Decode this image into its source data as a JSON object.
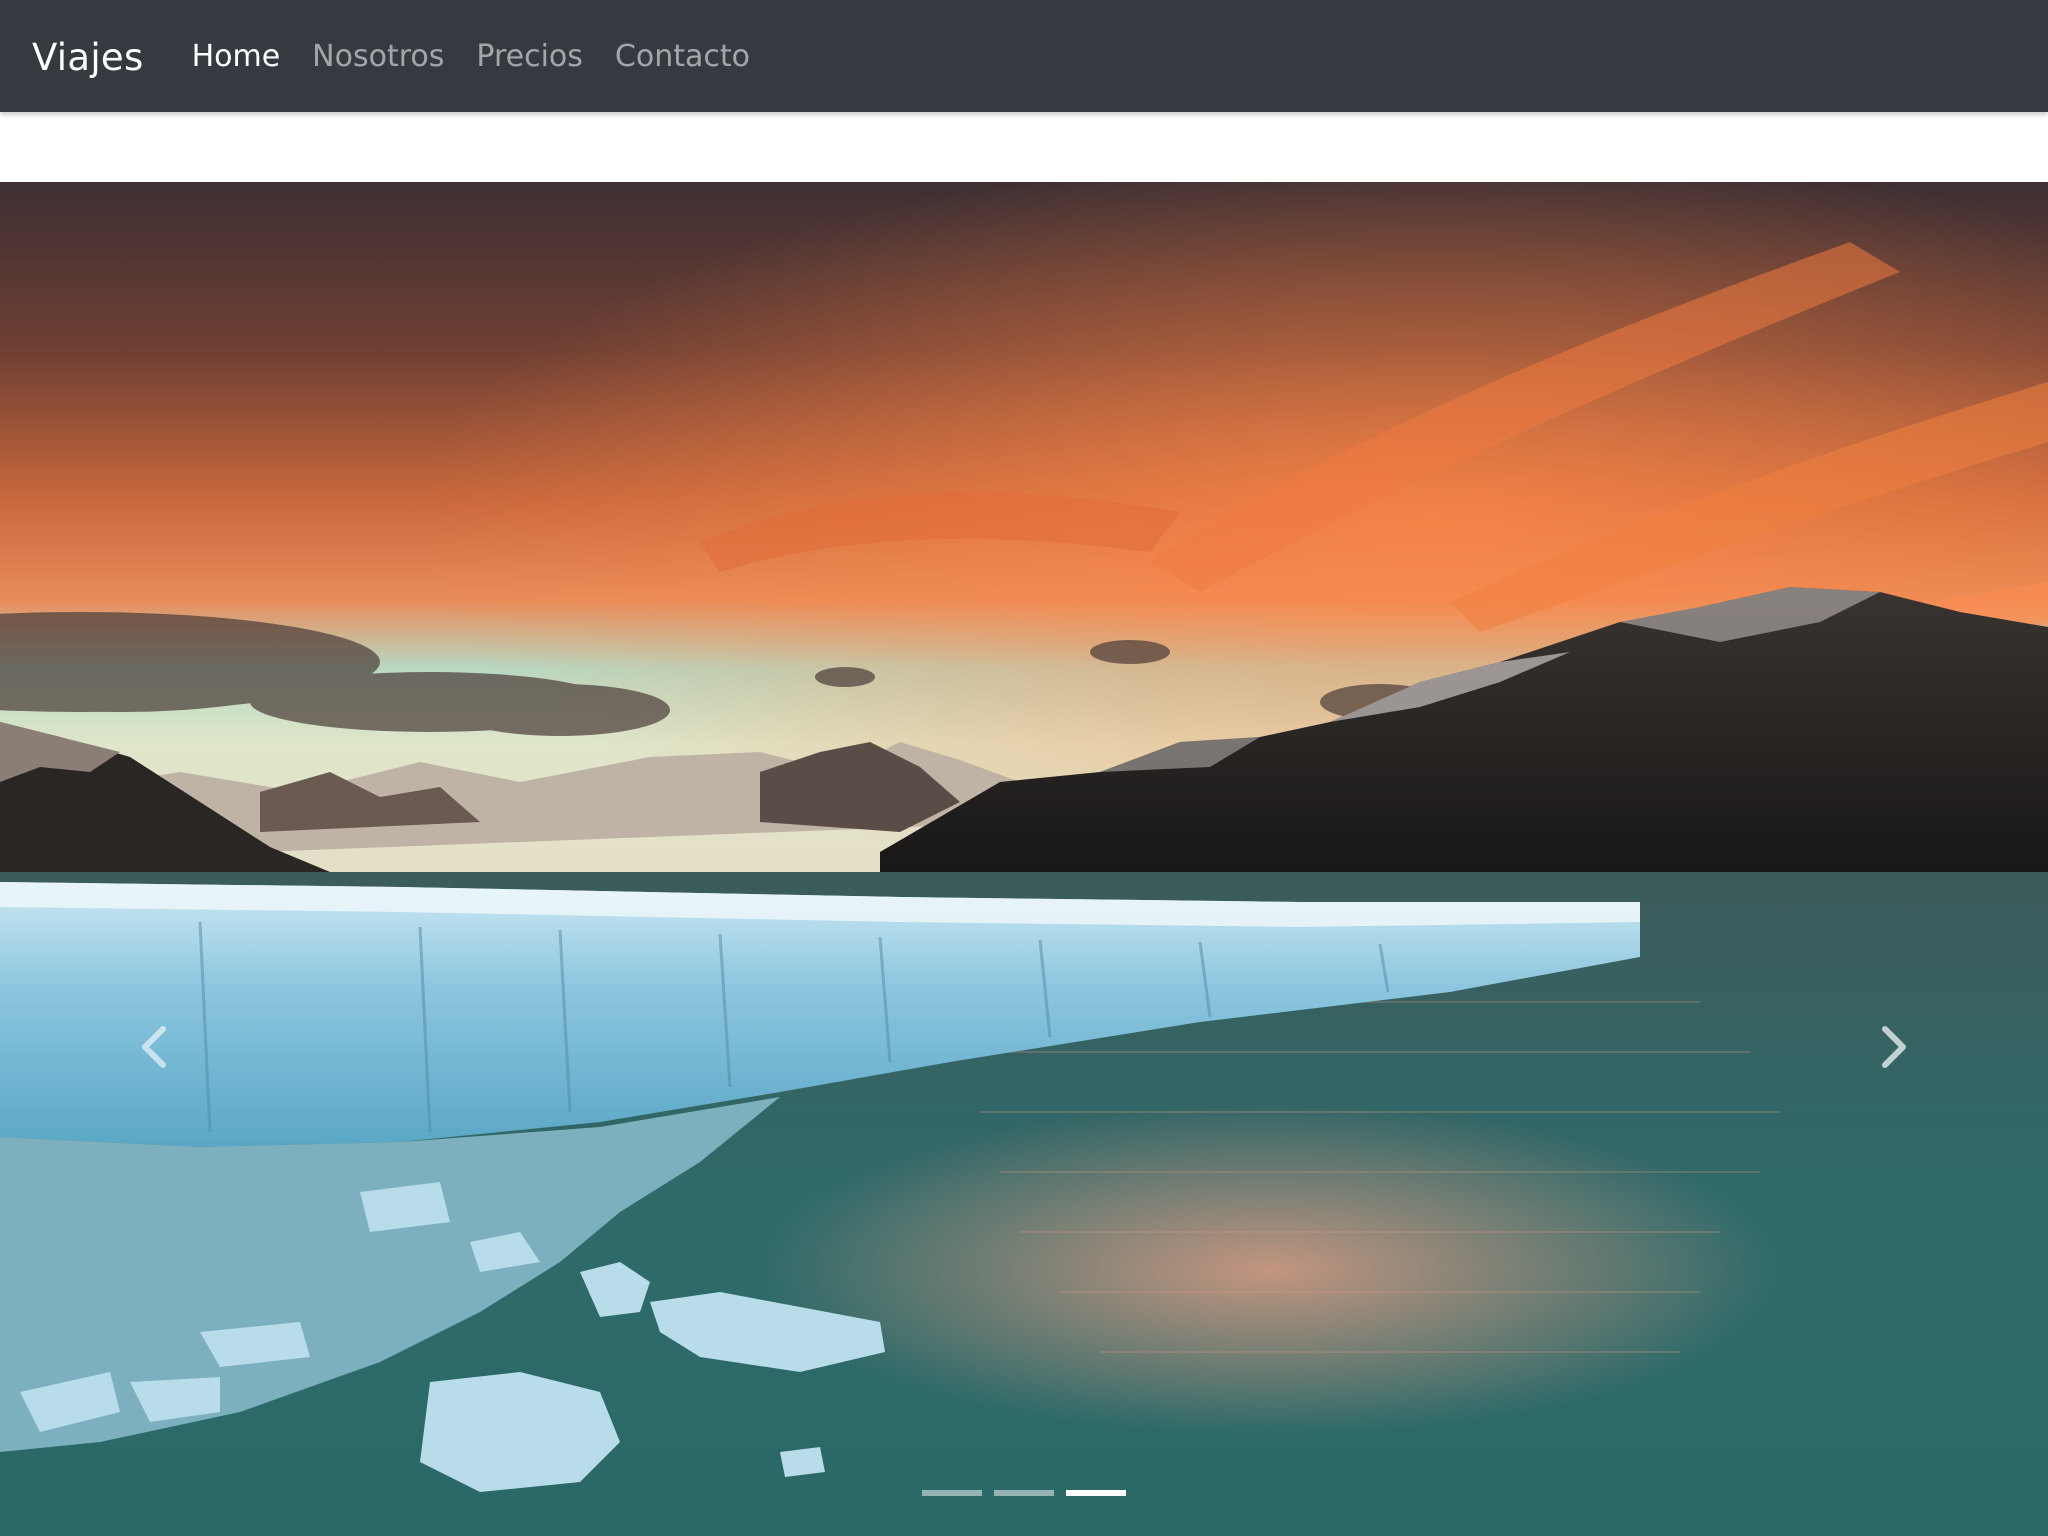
{
  "navbar": {
    "brand": "Viajes",
    "links": [
      {
        "label": "Home",
        "active": true
      },
      {
        "label": "Nosotros",
        "active": false
      },
      {
        "label": "Precios",
        "active": false
      },
      {
        "label": "Contacto",
        "active": false
      }
    ],
    "background": "#343a40"
  },
  "carousel": {
    "slide_description_icon": "glacier-sunset-photo",
    "prev_icon": "chevron-left-icon",
    "next_icon": "chevron-right-icon",
    "indicator_count": 3,
    "active_indicator": 3
  }
}
